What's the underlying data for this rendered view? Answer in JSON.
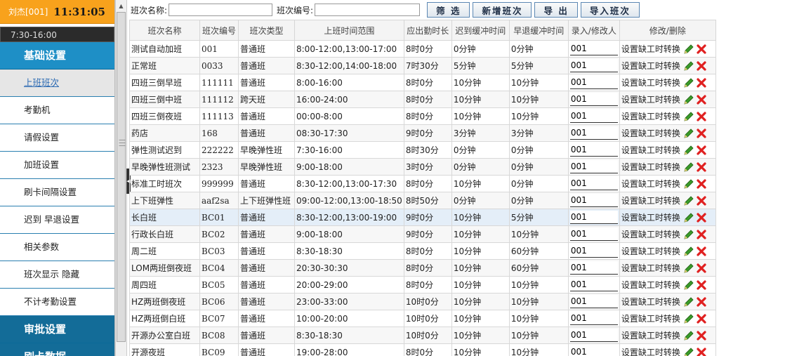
{
  "user": {
    "name": "刘杰[001]",
    "time": "11:31:05",
    "shift_time": "7:30-16:00"
  },
  "sidebar": {
    "header1": "基础设置",
    "items": [
      {
        "label": "上班班次",
        "active": true
      },
      {
        "label": "考勤机"
      },
      {
        "label": "请假设置"
      },
      {
        "label": "加班设置"
      },
      {
        "label": "刷卡间隔设置"
      },
      {
        "label": "迟到 早退设置"
      },
      {
        "label": "相关参数"
      },
      {
        "label": "班次显示 隐藏"
      },
      {
        "label": "不计考勤设置"
      }
    ],
    "header2": "审批设置",
    "header3": "刷卡数据"
  },
  "toolbar": {
    "name_label": "班次名称:",
    "name_value": "",
    "code_label": "班次编号:",
    "code_value": "",
    "filter_btn": "筛 选",
    "add_btn": "新增班次",
    "export_btn": "导 出",
    "import_btn": "导入班次"
  },
  "table": {
    "columns": [
      "班次名称",
      "班次编号",
      "班次类型",
      "上班时间范围",
      "应出勤时长",
      "迟到缓冲时间",
      "早退缓冲时间",
      "录入/修改人",
      "修改/删除"
    ],
    "op_link": "设置缺工时转换",
    "rows": [
      [
        "测试自动加班",
        "001",
        "普通班",
        "8:00-12:00,13:00-17:00",
        "8时0分",
        "0分钟",
        "0分钟",
        "001"
      ],
      [
        "正常班",
        "0033",
        "普通班",
        "8:30-12:00,14:00-18:00",
        "7时30分",
        "5分钟",
        "5分钟",
        "001"
      ],
      [
        "四班三倒早班",
        "111111",
        "普通班",
        "8:00-16:00",
        "8时0分",
        "10分钟",
        "10分钟",
        "001"
      ],
      [
        "四班三倒中班",
        "111112",
        "跨天班",
        "16:00-24:00",
        "8时0分",
        "10分钟",
        "10分钟",
        "001"
      ],
      [
        "四班三倒夜班",
        "111113",
        "普通班",
        "00:00-8:00",
        "8时0分",
        "10分钟",
        "10分钟",
        "001"
      ],
      [
        "药店",
        "168",
        "普通班",
        "08:30-17:30",
        "9时0分",
        "3分钟",
        "3分钟",
        "001"
      ],
      [
        "弹性测试迟到",
        "222222",
        "早晚弹性班",
        "7:30-16:00",
        "8时30分",
        "0分钟",
        "0分钟",
        "001"
      ],
      [
        "早晚弹性班测试",
        "2323",
        "早晚弹性班",
        "9:00-18:00",
        "3时0分",
        "0分钟",
        "0分钟",
        "001"
      ],
      [
        "标准工时班次",
        "999999",
        "普通班",
        "8:30-12:00,13:00-17:30",
        "8时0分",
        "10分钟",
        "0分钟",
        "001"
      ],
      [
        "上下班弹性",
        "aaf2sa",
        "上下班弹性班",
        "09:00-12:00,13:00-18:50",
        "8时50分",
        "0分钟",
        "0分钟",
        "001"
      ],
      [
        "长白班",
        "BC01",
        "普通班",
        "8:30-12:00,13:00-19:00",
        "9时0分",
        "10分钟",
        "5分钟",
        "001"
      ],
      [
        "行政长白班",
        "BC02",
        "普通班",
        "9:00-18:00",
        "9时0分",
        "10分钟",
        "10分钟",
        "001"
      ],
      [
        "周二班",
        "BC03",
        "普通班",
        "8:30-18:30",
        "8时0分",
        "10分钟",
        "60分钟",
        "001"
      ],
      [
        "LOM两班倒夜班",
        "BC04",
        "普通班",
        "20:30-30:30",
        "8时0分",
        "10分钟",
        "60分钟",
        "001"
      ],
      [
        "周四班",
        "BC05",
        "普通班",
        "20:00-29:00",
        "8时0分",
        "10分钟",
        "10分钟",
        "001"
      ],
      [
        "HZ两班倒夜班",
        "BC06",
        "普通班",
        "23:00-33:00",
        "10时0分",
        "10分钟",
        "10分钟",
        "001"
      ],
      [
        "HZ两班倒白班",
        "BC07",
        "普通班",
        "10:00-20:00",
        "10时0分",
        "10分钟",
        "10分钟",
        "001"
      ],
      [
        "开源办公室白班",
        "BC08",
        "普通班",
        "8:30-18:30",
        "10时0分",
        "10分钟",
        "10分钟",
        "001"
      ],
      [
        "开源夜班",
        "BC09",
        "普通班",
        "19:00-28:00",
        "8时0分",
        "10分钟",
        "10分钟",
        "001"
      ]
    ],
    "highlight_row": 10
  },
  "colors": {
    "accent": "#1e8fc6",
    "user_bar": "#f8a21c",
    "delete": "#e02020",
    "edit": "#3a9a2a"
  }
}
